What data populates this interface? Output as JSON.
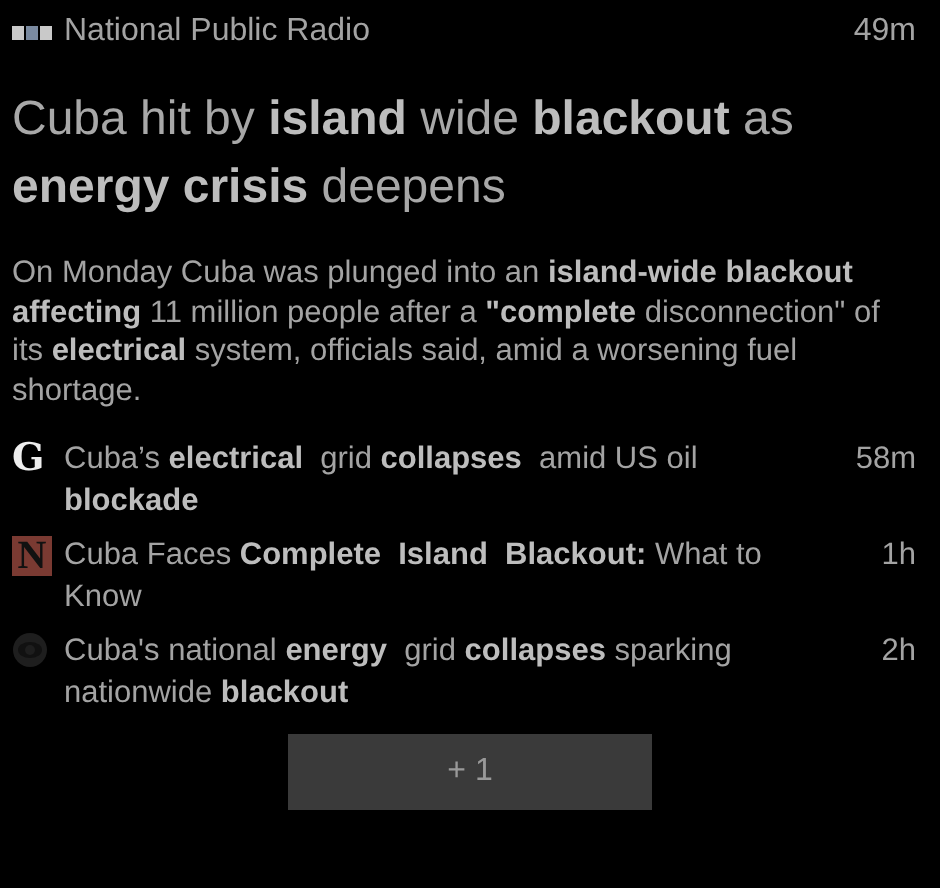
{
  "source": {
    "logo": {
      "kind": "npr"
    },
    "name": "National Public Radio",
    "time": "49m"
  },
  "headline": "Cuba hit by **island** wide **blackout** as **energy crisis** deepens",
  "summary": "On Monday Cuba was plunged into an **island-wide blackout affecting** 11 million people after a **\"complete** disconnection\" of its **electrical** system, officials said, amid a worsening fuel shortage.",
  "related": [
    {
      "logo": {
        "kind": "letter",
        "text": "G"
      },
      "title": "Cuba’s **electrical**  grid **collapses**  amid US oil **blockade**",
      "time": "58m"
    },
    {
      "logo": {
        "kind": "tile",
        "text": "N"
      },
      "title": "Cuba Faces **Complete  Island  Blackout:** What to Know",
      "time": "1h"
    },
    {
      "logo": {
        "kind": "eye"
      },
      "title": "Cuba's national **energy**  grid **collapses** sparking nationwide **blackout**",
      "time": "2h"
    }
  ],
  "more_button": "+ 1"
}
